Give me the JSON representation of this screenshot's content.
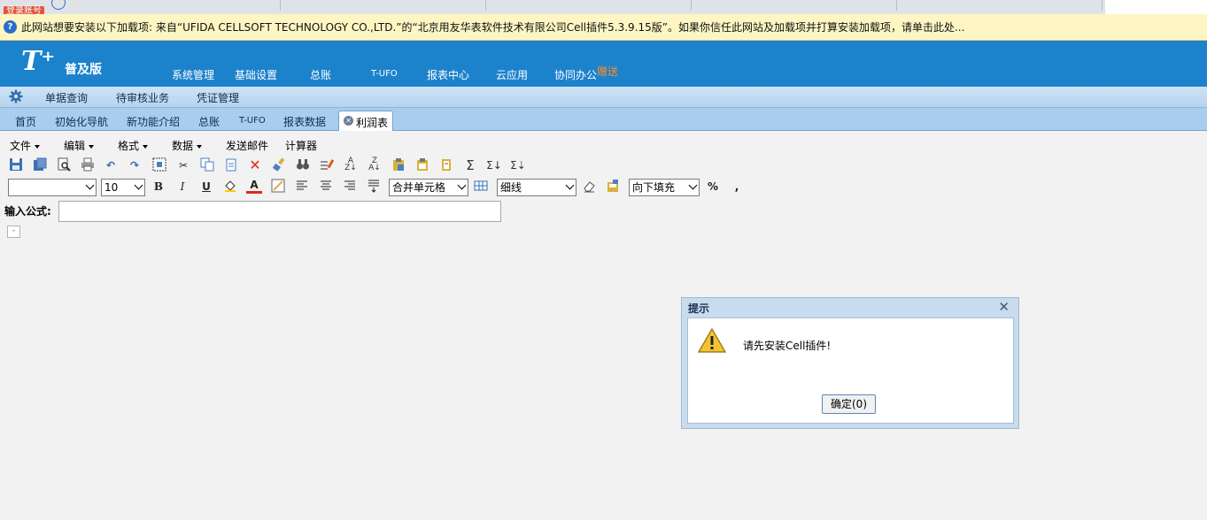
{
  "browser": {
    "login_badge": "登录账号"
  },
  "infobar": {
    "icon": "info-question-icon",
    "message": "此网站想要安装以下加载项: 来自“UFIDA CELLSOFT TECHNOLOGY CO.,LTD.”的“北京用友华表软件技术有限公司Cell插件5.3.9.15版”。如果你信任此网站及加载项并打算安装加载项，请单击此处..."
  },
  "header": {
    "logo": "T⁺",
    "edition": "普及版",
    "nav": [
      "系统管理",
      "基础设置",
      "总账",
      "T-UFO",
      "报表中心",
      "云应用",
      "协同办公"
    ],
    "gift": "赠送"
  },
  "submenu": {
    "items": [
      "单据查询",
      "待审核业务",
      "凭证管理"
    ]
  },
  "page_tabs": {
    "tabs": [
      "首页",
      "初始化导航",
      "新功能介绍",
      "总账",
      "T-UFO",
      "报表数据"
    ],
    "active": "利润表"
  },
  "menubar": {
    "items": [
      "文件",
      "编辑",
      "格式",
      "数据",
      "发送邮件",
      "计算器"
    ]
  },
  "toolbar2": {
    "font": "",
    "font_size": "10",
    "merge": "合并单元格",
    "border": "细线",
    "fill": "向下填充",
    "percent": "%",
    "comma": ","
  },
  "formula": {
    "label": "输入公式:",
    "value": ""
  },
  "mini_cell": "-",
  "dialog": {
    "title": "提示",
    "message": "请先安装Cell插件!",
    "ok_label": "确定(0)"
  }
}
